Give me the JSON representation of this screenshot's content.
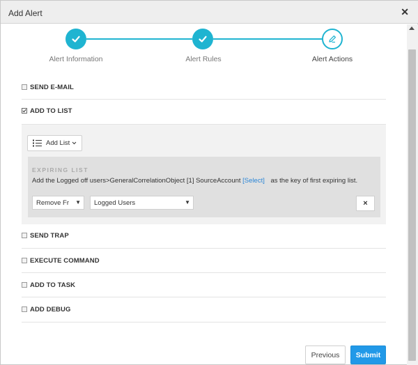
{
  "dialog": {
    "title": "Add Alert"
  },
  "steps": [
    {
      "label": "Alert Information",
      "state": "done",
      "icon": "check-icon"
    },
    {
      "label": "Alert Rules",
      "state": "done",
      "icon": "check-icon"
    },
    {
      "label": "Alert Actions",
      "state": "active",
      "icon": "pencil-icon"
    }
  ],
  "actions": {
    "send_email": {
      "label": "SEND E-MAIL",
      "checked": false
    },
    "add_to_list": {
      "label": "ADD TO LIST",
      "checked": true
    },
    "send_trap": {
      "label": "SEND TRAP",
      "checked": false
    },
    "execute_command": {
      "label": "EXECUTE COMMAND",
      "checked": false
    },
    "add_to_task": {
      "label": "ADD TO TASK",
      "checked": false
    },
    "add_debug": {
      "label": "ADD DEBUG",
      "checked": false
    }
  },
  "list_panel": {
    "add_list_label": "Add List",
    "expiring": {
      "title": "EXPIRING LIST",
      "text_before": "Add the Logged off users>GeneralCorrelationObject [1] SourceAccount",
      "select_link": "[Select]",
      "text_after": "as the key of first expiring list.",
      "operation_select": "Remove Fr",
      "list_select": "Logged Users",
      "delete_label": "×"
    }
  },
  "footer": {
    "previous": "Previous",
    "submit": "Submit"
  },
  "colors": {
    "accent": "#1fb4d1",
    "primary": "#2199e8",
    "link": "#2a85d6"
  }
}
